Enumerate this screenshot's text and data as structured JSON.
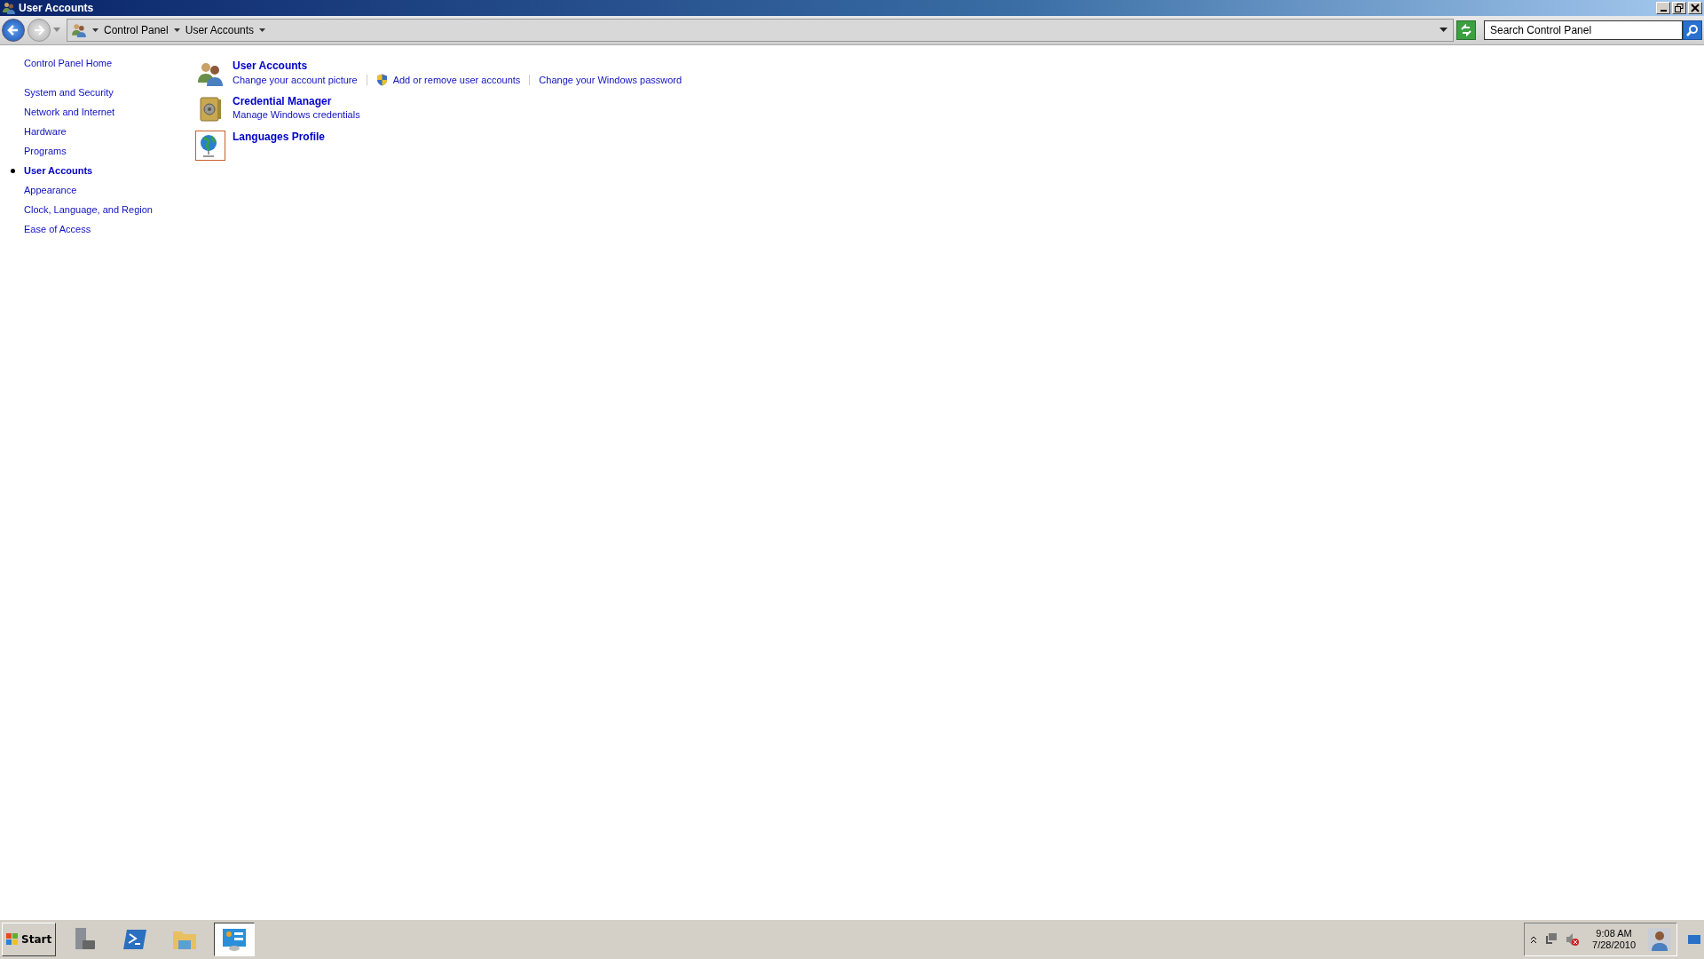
{
  "window": {
    "title": "User Accounts"
  },
  "address_bar": {
    "breadcrumbs": [
      "Control Panel",
      "User Accounts"
    ]
  },
  "search": {
    "placeholder": "Search Control Panel"
  },
  "sidebar": {
    "home": "Control Panel Home",
    "items": [
      {
        "label": "System and Security",
        "selected": false
      },
      {
        "label": "Network and Internet",
        "selected": false
      },
      {
        "label": "Hardware",
        "selected": false
      },
      {
        "label": "Programs",
        "selected": false
      },
      {
        "label": "User Accounts",
        "selected": true
      },
      {
        "label": "Appearance",
        "selected": false
      },
      {
        "label": "Clock, Language, and Region",
        "selected": false
      },
      {
        "label": "Ease of Access",
        "selected": false
      }
    ]
  },
  "categories": [
    {
      "kind": "users",
      "title": "User Accounts",
      "links": [
        {
          "label": "Change your account picture",
          "shield": false
        },
        {
          "label": "Add or remove user accounts",
          "shield": true
        },
        {
          "label": "Change your Windows password",
          "shield": false
        }
      ]
    },
    {
      "kind": "vault",
      "title": "Credential Manager",
      "links": [
        {
          "label": "Manage Windows credentials",
          "shield": false
        }
      ]
    },
    {
      "kind": "globe",
      "title": "Languages Profile"
    }
  ],
  "taskbar": {
    "start": "Start",
    "apps": [
      {
        "kind": "server",
        "selected": false
      },
      {
        "kind": "shell",
        "selected": false
      },
      {
        "kind": "folder",
        "selected": false
      },
      {
        "kind": "panel",
        "selected": true
      }
    ],
    "clock": {
      "time": "9:08 AM",
      "date": "7/28/2010"
    }
  }
}
